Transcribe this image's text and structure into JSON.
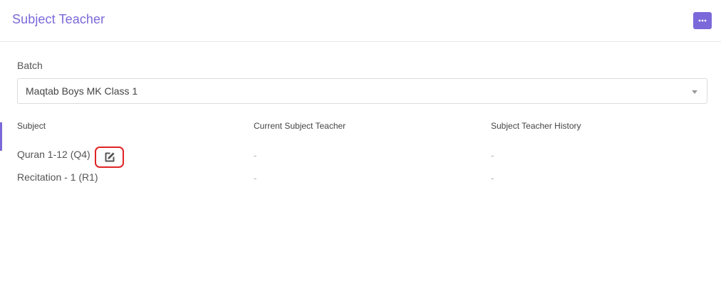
{
  "header": {
    "title": "Subject Teacher",
    "menu_icon": "more-horizontal-icon"
  },
  "form": {
    "batch_label": "Batch",
    "batch_value": "Maqtab Boys MK Class 1"
  },
  "table": {
    "columns": [
      "Subject",
      "Current Subject Teacher",
      "Subject Teacher History"
    ],
    "rows": [
      {
        "subject": "Quran 1-12 (Q4)",
        "current_teacher": "-",
        "history": "-",
        "edit_icon": "edit-icon"
      },
      {
        "subject": "Recitation - 1 (R1)",
        "current_teacher": "-",
        "history": "-"
      }
    ]
  },
  "colors": {
    "accent": "#7b68d9",
    "highlight": "#e02424"
  }
}
